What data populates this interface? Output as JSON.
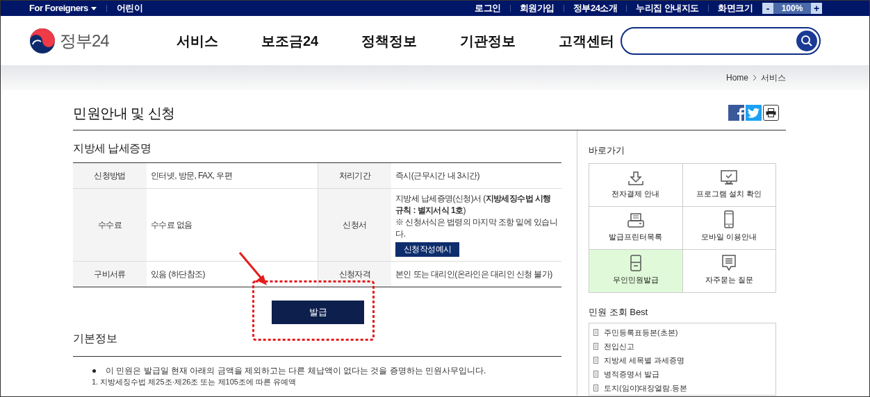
{
  "top_bar": {
    "left_links": [
      {
        "label": "For Foreigners",
        "dropdown": true
      },
      {
        "label": "어린이",
        "dropdown": false
      }
    ],
    "right_links": [
      "로그인",
      "회원가입",
      "정부24소개",
      "누리집 안내지도",
      "화면크기"
    ],
    "zoom": {
      "minus": "-",
      "value": "100%",
      "plus": "+"
    }
  },
  "header": {
    "logo_text": "정부24",
    "nav": [
      "서비스",
      "보조금24",
      "정책정보",
      "기관정보",
      "고객센터"
    ]
  },
  "breadcrumb": [
    "Home",
    "서비스"
  ],
  "page_title": "민원안내 및 신청",
  "section_title": "지방세 납세증명",
  "info_table": [
    {
      "cells": [
        {
          "label": "신청방법",
          "value": "인터넷, 방문, FAX, 우편"
        },
        {
          "label": "처리기간",
          "value": "즉시(근무시간 내 3시간)"
        }
      ]
    },
    {
      "cells": [
        {
          "label": "수수료",
          "value": "수수료 없음"
        },
        {
          "label": "신청서",
          "value": "지방세 납세증명(신청)서 (**지방세징수법 시행규칙 : 별지서식 1호**)",
          "note": "※ 신청서식은 법령의 마지막 조항 밑에 있습니다.",
          "button": "신청작성예시"
        }
      ]
    },
    {
      "cells": [
        {
          "label": "구비서류",
          "value": "있음 (하단참조)"
        },
        {
          "label": "신청자격",
          "value": "본인 또는 대리인(온라인은 대리인 신청 불가)"
        }
      ]
    }
  ],
  "issue_button": "발급",
  "basic_info": {
    "title": "기본정보",
    "bullet": "이 민원은 발급일 현재 아래의 금액을 제외하고는 다른 체납액이 없다는 것을 증명하는 민원사무입니다.",
    "line": "1. 지방세징수법 제25조·제26조 또는 제105조에 따른 유예액"
  },
  "sidebar": {
    "quick_title": "바로가기",
    "quick_links": [
      {
        "label": "전자결제 안내",
        "selected": false
      },
      {
        "label": "프로그램 설치 확인",
        "selected": false
      },
      {
        "label": "발급프린터목록",
        "selected": false
      },
      {
        "label": "모바일 이용안내",
        "selected": false
      },
      {
        "label": "무인민원발급",
        "selected": true
      },
      {
        "label": "자주묻는 질문",
        "selected": false
      }
    ],
    "best_title": "민원 조회 Best",
    "best_items": [
      "주민등록표등본(초본)",
      "전입신고",
      "지방세 세목별 과세증명",
      "병적증명서 발급",
      "토지(임야)대장열람.등본"
    ]
  }
}
